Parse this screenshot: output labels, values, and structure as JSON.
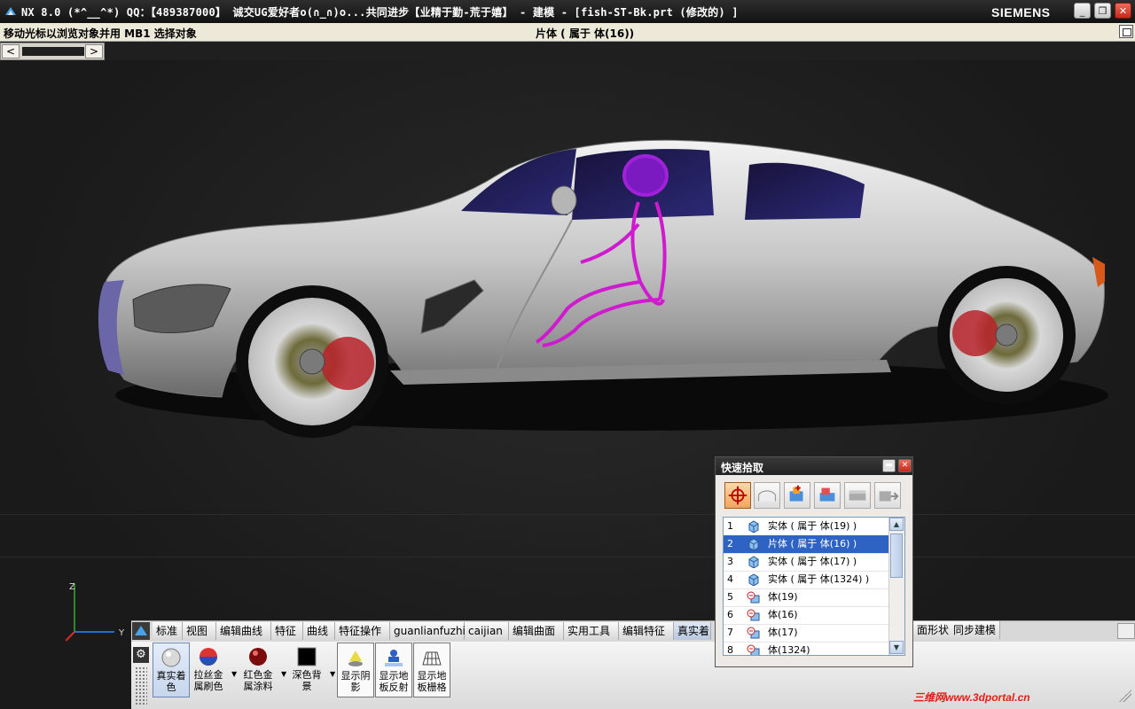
{
  "window": {
    "title": "NX 8.0 (*^__^*) QQ：【489387000】 诚交UG爱好者o(∩_∩)o...共同进步【业精于勤-荒于嬉】 - 建模 - [fish-ST-Bk.prt  (修改的) ]",
    "brand": "SIEMENS",
    "minimize": "_",
    "restore": "❐",
    "close": "✕"
  },
  "statusbar": {
    "prompt": "移动光标以浏览对象并用 MB1 选择对象",
    "status": "片体 ( 属于 体(16))"
  },
  "triad": {
    "z": "Z",
    "y": "Y"
  },
  "ribbon": {
    "tabs": [
      "标准",
      "视图",
      "编辑曲线",
      "特征",
      "曲线",
      "特征操作",
      "guanlianfuzhi",
      "caijian",
      "编辑曲面",
      "实用工具",
      "编辑特征",
      "真实着"
    ],
    "active_tab": "真实着",
    "tail_tabs": [
      "面形状",
      "同步建模"
    ],
    "tools": [
      {
        "label": "真实着色",
        "icon": "shaded-sphere-icon"
      },
      {
        "label": "拉丝金属刷色",
        "icon": "brushed-metal-icon"
      },
      {
        "label": "红色金属涂料",
        "icon": "red-metal-paint-icon"
      },
      {
        "label": "深色背景",
        "icon": "dark-background-icon"
      },
      {
        "label": "显示阴影",
        "icon": "shadow-icon"
      },
      {
        "label": "显示地板反射",
        "icon": "floor-reflection-icon"
      },
      {
        "label": "显示地板栅格",
        "icon": "floor-grid-icon"
      }
    ]
  },
  "watermark": "三维网www.3dportal.cn",
  "quick_pick": {
    "title": "快速拾取",
    "rows": [
      {
        "n": "1",
        "text": "实体 ( 属于 体(19) )",
        "kind": "solid"
      },
      {
        "n": "2",
        "text": "片体 ( 属于 体(16) )",
        "kind": "solid"
      },
      {
        "n": "3",
        "text": "实体 ( 属于 体(17) )",
        "kind": "solid"
      },
      {
        "n": "4",
        "text": "实体 ( 属于 体(1324) )",
        "kind": "solid"
      },
      {
        "n": "5",
        "text": "体(19)",
        "kind": "body"
      },
      {
        "n": "6",
        "text": "体(16)",
        "kind": "body"
      },
      {
        "n": "7",
        "text": "体(17)",
        "kind": "body"
      },
      {
        "n": "8",
        "text": "体(1324)",
        "kind": "body"
      }
    ],
    "selected_index": 1,
    "filters": [
      "all-objects-filter-icon",
      "sheet-filter-icon",
      "add-body-filter-icon",
      "solid-body-filter-icon",
      "feature-filter-icon",
      "component-filter-icon"
    ]
  },
  "colors": {
    "title_bg": "#1a1a1a",
    "viewport_bg": "#1f1f1f",
    "mannequin": "#d01ad0",
    "selection": "#2e63c4",
    "car_body": "#c9c9c9"
  }
}
